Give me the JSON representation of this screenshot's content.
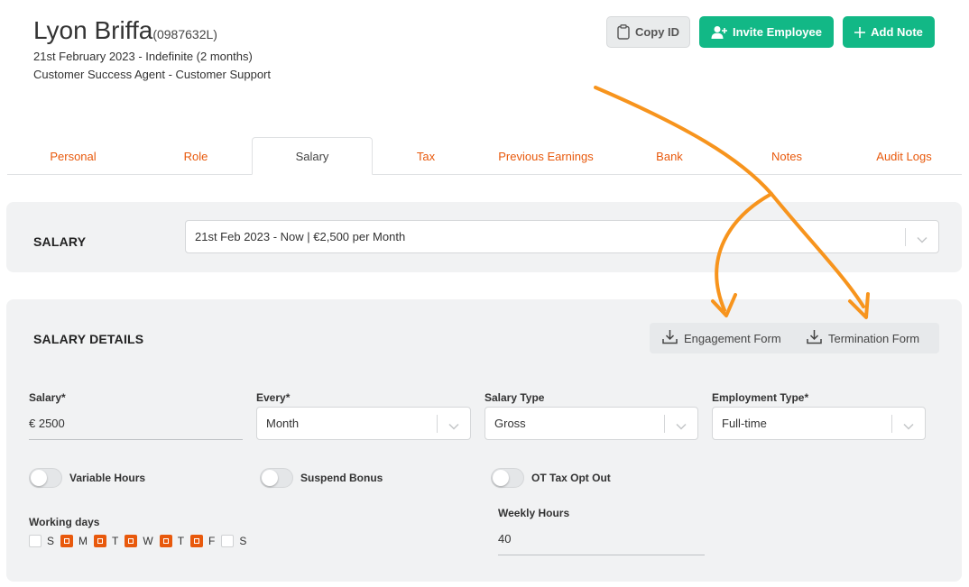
{
  "employee": {
    "name": "Lyon Briffa",
    "id": "(0987632L)",
    "period": "21st February 2023 - Indefinite (2 months)",
    "role": "Customer Success Agent - Customer Support"
  },
  "actions": {
    "copy_id": "Copy ID",
    "invite": "Invite Employee",
    "add_note": "Add Note"
  },
  "tabs": [
    {
      "label": "Personal"
    },
    {
      "label": "Role"
    },
    {
      "label": "Salary"
    },
    {
      "label": "Tax"
    },
    {
      "label": "Previous Earnings"
    },
    {
      "label": "Bank"
    },
    {
      "label": "Notes"
    },
    {
      "label": "Audit Logs"
    }
  ],
  "active_tab": "Salary",
  "salary_panel": {
    "title": "SALARY",
    "selected_period": "21st Feb 2023 - Now | €2,500 per Month"
  },
  "details": {
    "title": "SALARY DETAILS",
    "engagement_form": "Engagement Form",
    "termination_form": "Termination Form",
    "salary_label": "Salary*",
    "salary_value": "€ 2500",
    "every_label": "Every*",
    "every_value": "Month",
    "salary_type_label": "Salary Type",
    "salary_type_value": "Gross",
    "employment_type_label": "Employment Type*",
    "employment_type_value": "Full-time",
    "variable_hours": "Variable Hours",
    "suspend_bonus": "Suspend Bonus",
    "ot_tax_opt_out": "OT Tax Opt Out",
    "working_days_label": "Working days",
    "weekly_hours_label": "Weekly Hours",
    "weekly_hours_value": "40"
  },
  "working_days": [
    {
      "label": "S",
      "checked": false
    },
    {
      "label": "M",
      "checked": true
    },
    {
      "label": "T",
      "checked": true
    },
    {
      "label": "W",
      "checked": true
    },
    {
      "label": "T",
      "checked": true
    },
    {
      "label": "F",
      "checked": true
    },
    {
      "label": "S",
      "checked": false
    }
  ],
  "colors": {
    "accent": "#e8590c",
    "primary_button": "#12b886",
    "annotation_arrow": "#f7941d"
  }
}
